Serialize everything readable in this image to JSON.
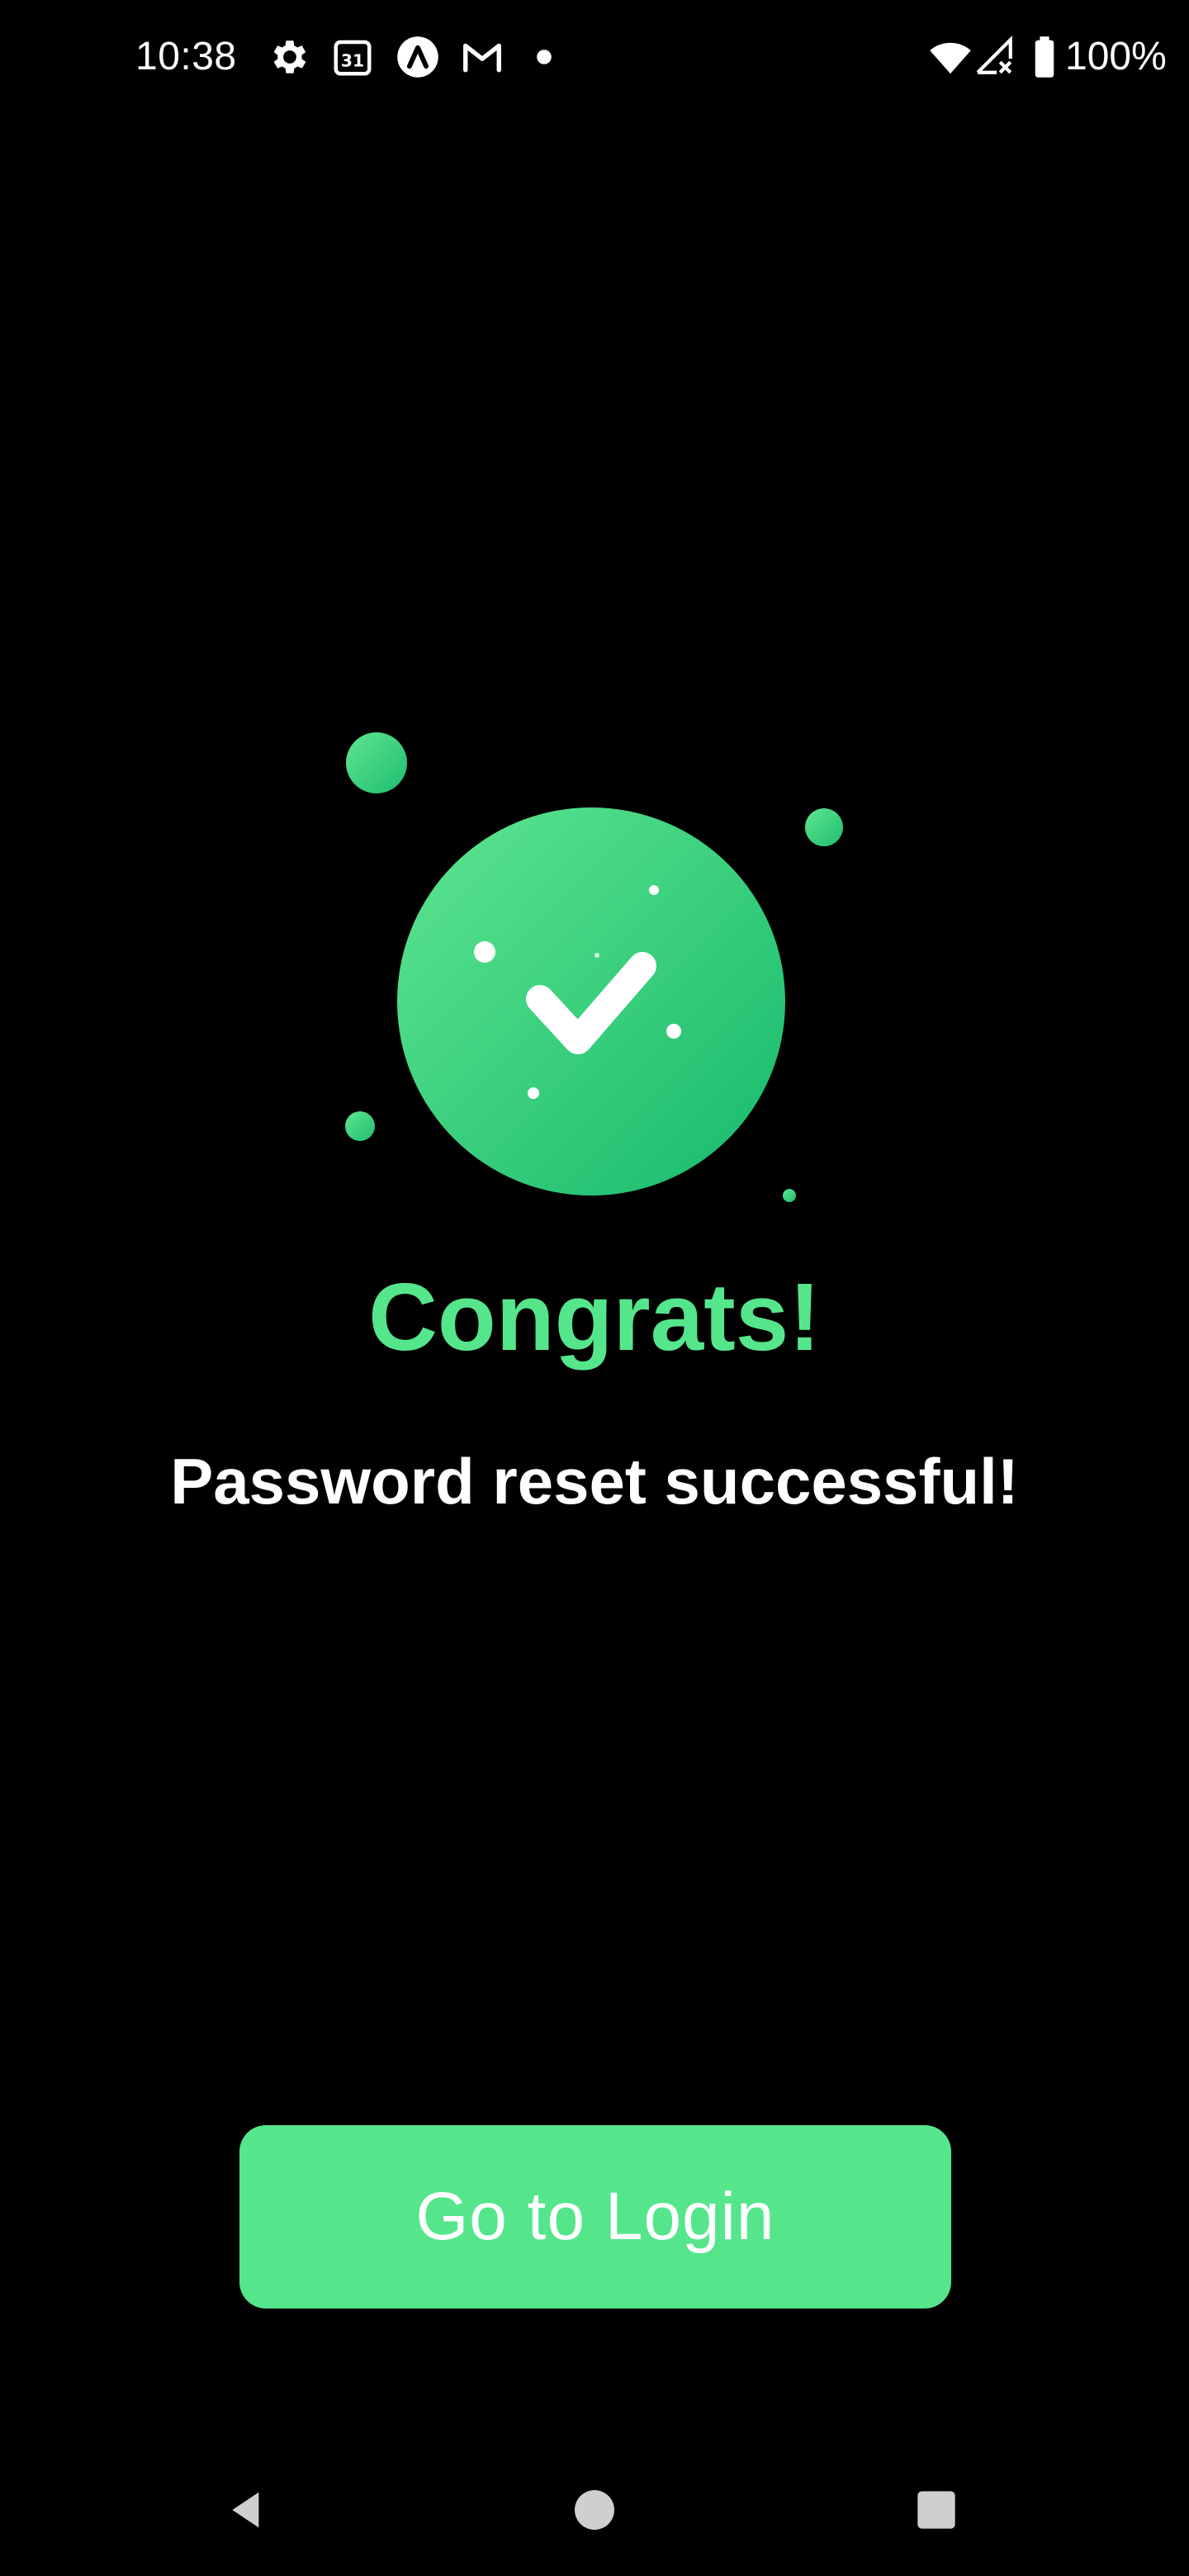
{
  "status_bar": {
    "time": "10:38",
    "battery_percent": "100%",
    "icons": [
      "gear-icon",
      "calendar-icon",
      "app-icon",
      "gmail-icon",
      "dot-icon",
      "wifi-icon",
      "signal-icon",
      "battery-icon"
    ],
    "calendar_day": "31"
  },
  "main": {
    "title": "Congrats!",
    "subtitle": "Password reset successful!",
    "illustration_icon": "check-icon"
  },
  "actions": {
    "go_to_login_label": "Go to Login"
  },
  "nav": {
    "icons": [
      "back-icon",
      "home-icon",
      "recents-icon"
    ]
  },
  "colors": {
    "background": "#000000",
    "accent": "#55e68c",
    "accent_dark": "#1ebd70",
    "text": "#ffffff"
  }
}
